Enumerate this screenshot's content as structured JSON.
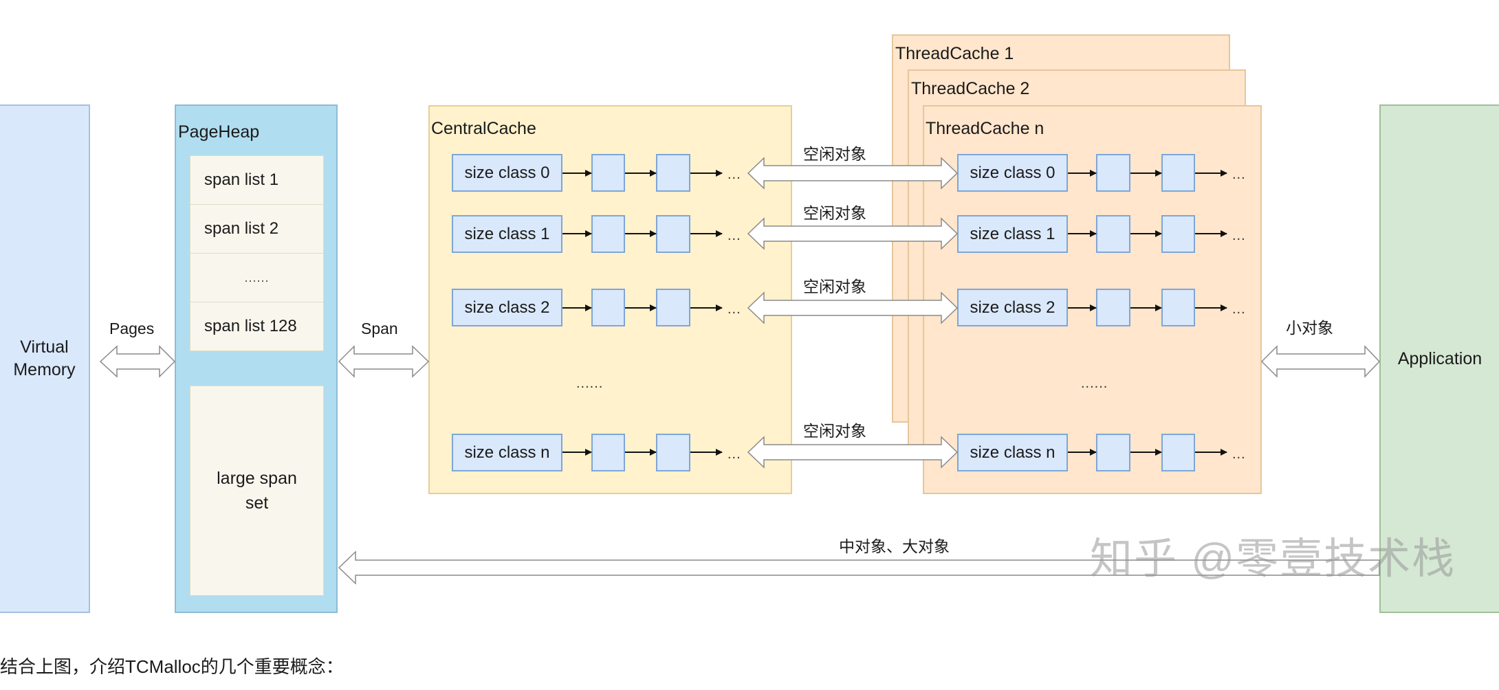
{
  "virtual_memory": {
    "label_line1": "Virtual",
    "label_line2": "Memory"
  },
  "page_heap": {
    "title": "PageHeap",
    "span_lists": [
      "span list 1",
      "span list 2",
      "......",
      "span list 128"
    ],
    "large_span_line1": "large span",
    "large_span_line2": "set"
  },
  "central_cache": {
    "title": "CentralCache",
    "size_classes": [
      "size class 0",
      "size class 1",
      "size class 2",
      "size class n"
    ],
    "middle_ellipsis": "......"
  },
  "thread_caches": {
    "titles": [
      "ThreadCache 1",
      "ThreadCache 2",
      "ThreadCache n"
    ],
    "size_classes": [
      "size class 0",
      "size class 1",
      "size class 2",
      "size class n"
    ],
    "middle_ellipsis": "......"
  },
  "application": {
    "label": "Application"
  },
  "chain_ellipsis": "...",
  "edges": {
    "pages": "Pages",
    "span": "Span",
    "free_object": "空闲对象",
    "small_object": "小对象",
    "medium_large_object": "中对象、大对象"
  },
  "watermark": "知乎 @零壹技术栈",
  "caption": "结合上图，介绍TCMalloc的几个重要概念："
}
